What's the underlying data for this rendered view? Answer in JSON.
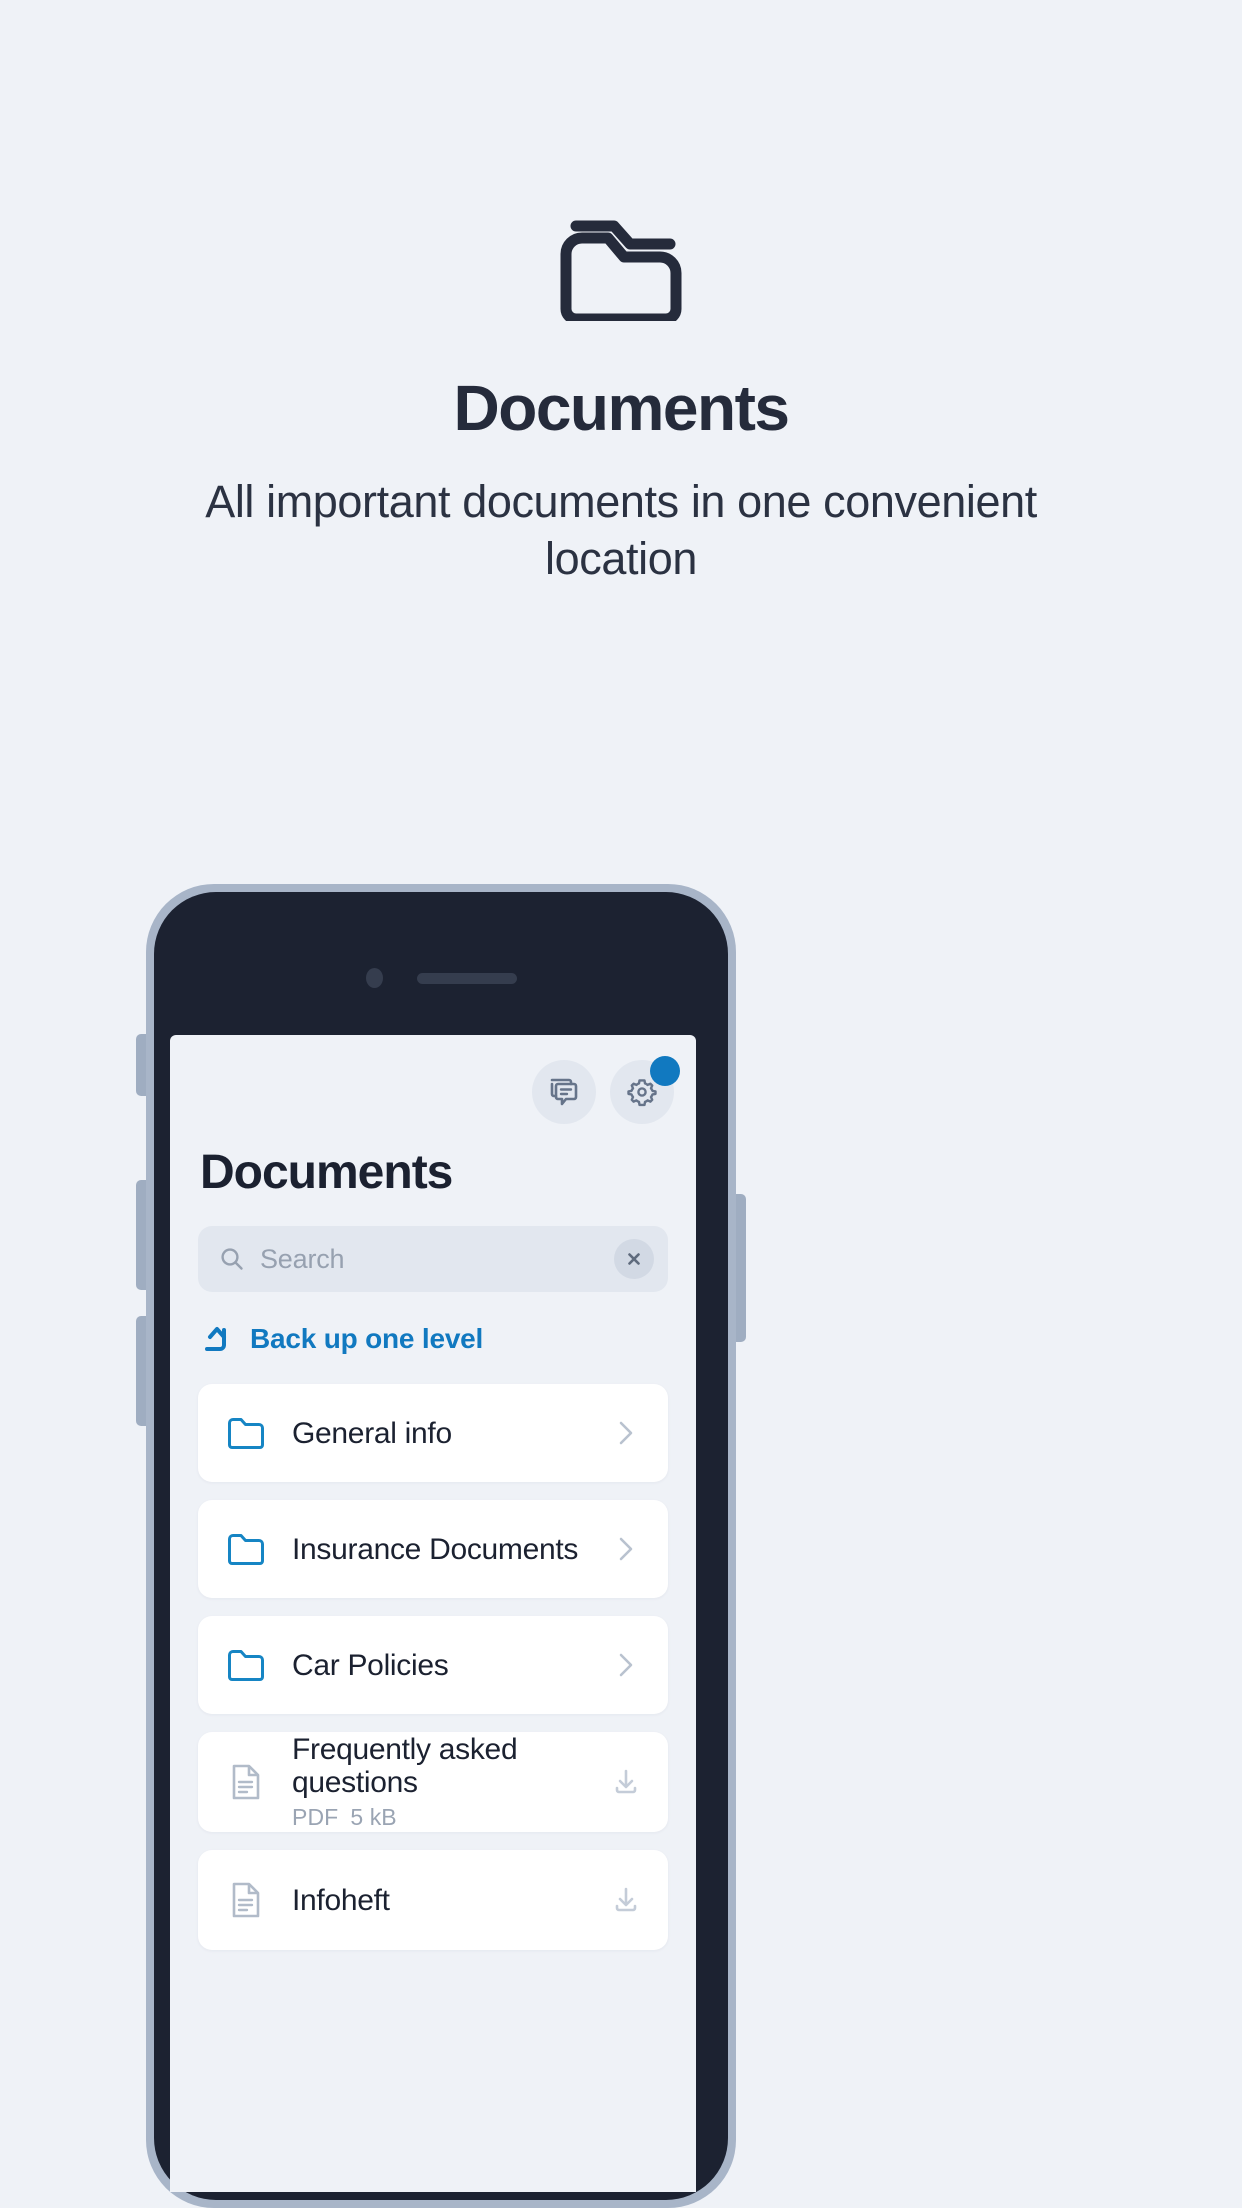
{
  "hero": {
    "icon": "folder-outline-icon",
    "title": "Documents",
    "subtitle": "All important documents in one convenient location"
  },
  "colors": {
    "page_background": "#eff2f7",
    "heading": "#252b3b",
    "accent_blue": "#1179c0",
    "phone_bezel": "#a8b5c8",
    "phone_body": "#1c2231",
    "card_background": "#ffffff",
    "muted_text": "#9aa4b3"
  },
  "phone": {
    "camera": "camera-dot-icon",
    "speaker": "speaker-grille-icon",
    "buttons": [
      "silent-switch",
      "volume-up-button",
      "volume-down-button",
      "power-button"
    ]
  },
  "app": {
    "topbar": {
      "messages_icon": "chat-bubbles-icon",
      "settings_icon": "gear-icon",
      "settings_badge": true
    },
    "title": "Documents",
    "search": {
      "icon": "search-icon",
      "placeholder": "Search",
      "value": "",
      "clear_icon": "close-icon"
    },
    "back_link": {
      "icon": "arrow-up-left-icon",
      "label": "Back up one level"
    },
    "items": [
      {
        "type": "folder",
        "icon": "folder-icon",
        "label": "General info",
        "meta_type": "",
        "meta_size": "",
        "action": "chevron-right-icon"
      },
      {
        "type": "folder",
        "icon": "folder-icon",
        "label": "Insurance Documents",
        "meta_type": "",
        "meta_size": "",
        "action": "chevron-right-icon"
      },
      {
        "type": "folder",
        "icon": "folder-icon",
        "label": "Car Policies",
        "meta_type": "",
        "meta_size": "",
        "action": "chevron-right-icon"
      },
      {
        "type": "file",
        "icon": "document-icon",
        "label": "Frequently asked questions",
        "meta_type": "PDF",
        "meta_size": "5 kB",
        "action": "download-icon"
      },
      {
        "type": "file",
        "icon": "document-icon",
        "label": "Infoheft",
        "meta_type": "",
        "meta_size": "",
        "action": "download-icon"
      }
    ]
  }
}
